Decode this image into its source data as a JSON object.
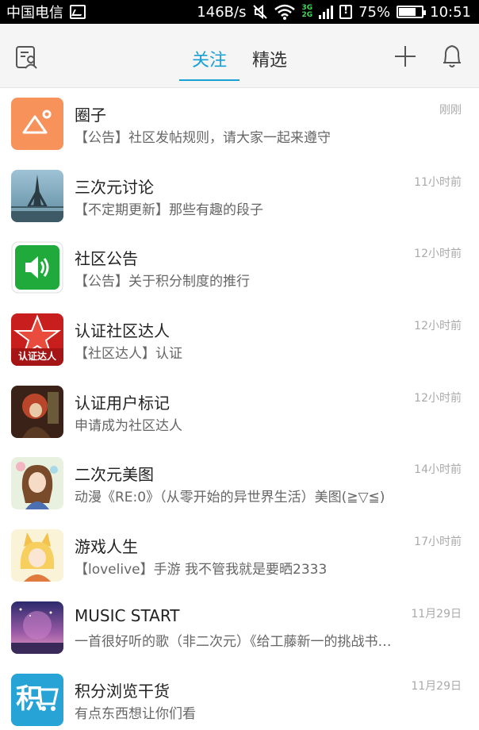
{
  "status_bar": {
    "carrier": "中国电信",
    "net_speed": "146B/s",
    "network_top": "3G",
    "network_bottom": "2G",
    "battery": "75%",
    "battery_level": 0.75,
    "time": "10:51"
  },
  "header": {
    "tabs": [
      {
        "label": "关注",
        "active": true
      },
      {
        "label": "精选",
        "active": false
      }
    ],
    "accent_color": "#1a9fd4"
  },
  "feed": [
    {
      "title": "圈子",
      "subtitle": "【公告】社区发帖规则，请大家一起来遵守",
      "time": "刚刚",
      "avatar": "photo-placeholder-icon"
    },
    {
      "title": "三次元讨论",
      "subtitle": "【不定期更新】那些有趣的段子",
      "time": "11小时前",
      "avatar": "eiffel-tower-photo"
    },
    {
      "title": "社区公告",
      "subtitle": "【公告】关于积分制度的推行",
      "time": "12小时前",
      "avatar": "speaker-icon"
    },
    {
      "title": "认证社区达人",
      "subtitle": "【社区达人】认证",
      "time": "12小时前",
      "avatar": "star-badge-icon",
      "avatar_text": "认证达人"
    },
    {
      "title": "认证用户标记",
      "subtitle": "申请成为社区达人",
      "time": "12小时前",
      "avatar": "anime-character-avatar"
    },
    {
      "title": "二次元美图",
      "subtitle": "动漫《RE:0》（从零开始的异世界生活）美图(≧▽≦)",
      "time": "14小时前",
      "avatar": "anime-girl-avatar"
    },
    {
      "title": "游戏人生",
      "subtitle": "【lovelive】手游 我不管我就是要晒2333",
      "time": "17小时前",
      "avatar": "fox-girl-avatar"
    },
    {
      "title": "MUSIC START",
      "subtitle": "一首很好听的歌（非二次元）《给工藤新一的挑战书…",
      "time": "11月29日",
      "avatar": "galaxy-scene-avatar"
    },
    {
      "title": "积分浏览干货",
      "subtitle": "有点东西想让你们看",
      "time": "11月29日",
      "avatar": "points-cart-icon",
      "avatar_text": "积"
    }
  ]
}
